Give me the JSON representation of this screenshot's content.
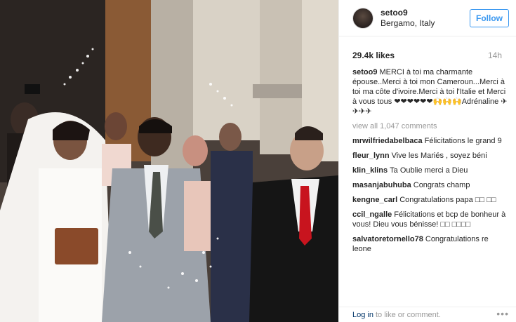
{
  "post": {
    "username": "setoo9",
    "location": "Bergamo, Italy",
    "follow_label": "Follow",
    "likes": "29.4k likes",
    "age": "14h",
    "caption_user": "setoo9",
    "caption_text": "MERCI à toi ma charmante épouse..Merci à toi mon Cameroun...Merci à toi ma côte d'ivoire.Merci à toi l'Italie et Merci à vous tous ❤❤❤❤❤❤🙌🙌🙌Adrénaline ✈✈✈✈",
    "view_all": "view all 1,047 comments"
  },
  "comments": [
    {
      "user": "mrwilfriedabelbaca",
      "text": "Félicitations le grand 9"
    },
    {
      "user": "fleur_lynn",
      "text": "Vive les Mariés , soyez béni"
    },
    {
      "user": "klin_klins",
      "text": "Ta Oublie merci a Dieu"
    },
    {
      "user": "masanjabuhuba",
      "text": "Congrats champ"
    },
    {
      "user": "kengne_carl",
      "text": "Congratulations papa □□ □□"
    },
    {
      "user": "ccil_ngalle",
      "text": "Félicitations et bcp de bonheur à vous! Dieu vous bénisse! □□ □□□□"
    },
    {
      "user": "salvatoretornello78",
      "text": "Congratulations re leone"
    }
  ],
  "footer": {
    "login_link": "Log in",
    "login_rest": "to like or comment.",
    "more_icon": "ellipsis-icon"
  }
}
